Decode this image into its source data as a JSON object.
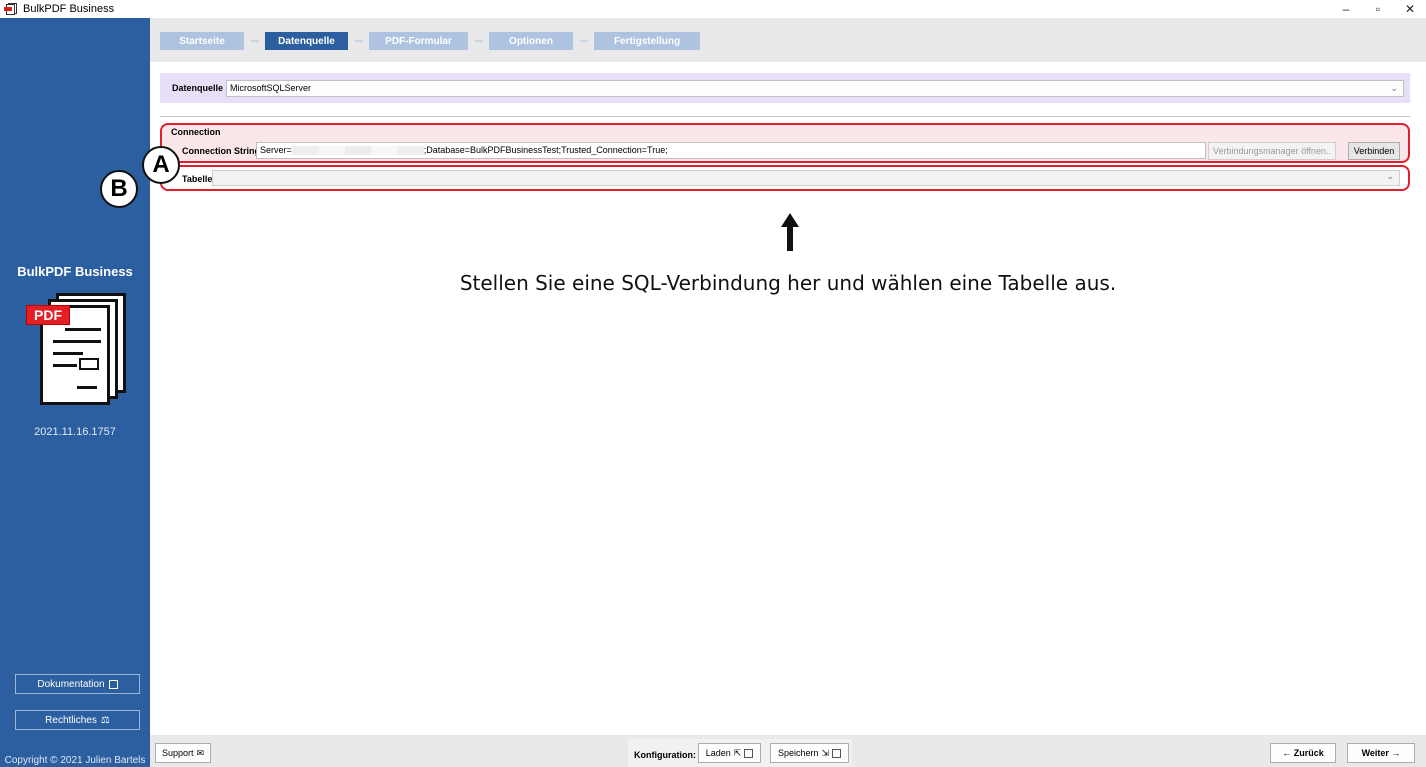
{
  "window": {
    "title": "BulkPDF Business",
    "controls": {
      "minimize": "–",
      "restore": "▫",
      "close": "✕"
    }
  },
  "sidebar": {
    "brand": "BulkPDF Business",
    "logo_text": "PDF",
    "version": "2021.11.16.1757",
    "documentation_label": "Dokumentation",
    "legal_label": "Rechtliches",
    "copyright": "Copyright © 2021 Julien Bartels"
  },
  "tabs": [
    {
      "label": "Startseite",
      "active": false
    },
    {
      "label": "Datenquelle",
      "active": true
    },
    {
      "label": "PDF-Formular",
      "active": false
    },
    {
      "label": "Optionen",
      "active": false
    },
    {
      "label": "Fertigstellung",
      "active": false
    }
  ],
  "datasource": {
    "label": "Datenquelle",
    "selected": "MicrosoftSQLServer"
  },
  "connection": {
    "heading": "Connection",
    "label": "Connection String:",
    "value_prefix": "Server=",
    "value_suffix": ";Database=BulkPDFBusinessTest;Trusted_Connection=True;",
    "manager_button": "Verbindungsmanager öffnen..",
    "connect_button": "Verbinden"
  },
  "table": {
    "label": "Tabelle:",
    "selected": ""
  },
  "markers": {
    "a": "A",
    "b": "B"
  },
  "hint": "Stellen Sie eine SQL-Verbindung her und wählen eine Tabelle aus.",
  "bottom": {
    "support": "Support",
    "konfiguration": "Konfiguration:",
    "load": "Laden",
    "save": "Speichern",
    "back": "← Zurück",
    "next": "Weiter →"
  },
  "colors": {
    "sidebar": "#2c5fa0",
    "tab_inactive": "#adc3df",
    "tab_active": "#2c5fa0",
    "highlight": "#e0202c",
    "datasource_bg": "#e8def7"
  }
}
